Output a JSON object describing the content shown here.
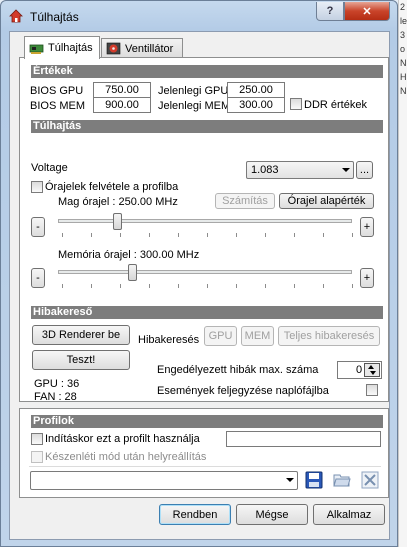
{
  "window": {
    "title": "Túlhajtás",
    "help_label": "?",
    "close_label": "✕"
  },
  "tabs": [
    {
      "label": "Túlhajtás",
      "icon": "gpu-card-icon",
      "active": true
    },
    {
      "label": "Ventillátor",
      "icon": "fan-icon",
      "active": false
    }
  ],
  "values": {
    "title": "Értékek",
    "bios_gpu_label": "BIOS GPU",
    "bios_gpu": "750.00",
    "current_gpu_label": "Jelenlegi GPU",
    "current_gpu": "250.00",
    "bios_mem_label": "BIOS MEM",
    "bios_mem": "900.00",
    "current_mem_label": "Jelenlegi MEM",
    "current_mem": "300.00",
    "ddr_label": "DDR értékek"
  },
  "overclock": {
    "title": "Túlhajtás",
    "voltage_label": "Voltage",
    "voltage_value": "1.083",
    "ellipsis": "...",
    "record_clocks_label": "Órajelek felvétele a profilba",
    "core_clock_label": "Mag órajel : 250.00 MHz",
    "calc_button": "Számítás",
    "default_clock_button": "Órajel alapérték",
    "minus": "-",
    "plus": "+",
    "mem_clock_label": "Memória órajel : 300.00 MHz",
    "core_slider_fraction": 0.2,
    "mem_slider_fraction": 0.2
  },
  "debugger": {
    "title": "Hibakereső",
    "renderer_button": "3D Renderer be",
    "debug_label": "Hibakeresés",
    "gpu_button": "GPU",
    "mem_button": "MEM",
    "full_debug_button": "Teljes hibakeresés",
    "test_button": "Teszt!",
    "max_errors_label": "Engedélyezett hibák max. száma",
    "max_errors_value": "0",
    "log_events_label": "Események feljegyzése naplófájlba",
    "gpu_status": "GPU : 36",
    "fan_status": "FAN : 28"
  },
  "profiles": {
    "title": "Profilok",
    "startup_label": "Indításkor ezt a profilt használja",
    "restore_label": "Készenléti mód után helyreállítás"
  },
  "footer": {
    "ok": "Rendben",
    "cancel": "Mégse",
    "apply": "Alkalmaz"
  },
  "background_text": [
    "2",
    "le",
    "3",
    "o",
    "N",
    "H",
    "N"
  ],
  "colors": {
    "section_bar": "#7d7d7d",
    "close_button": "#c9442a",
    "accent": "#3c7fb1"
  }
}
